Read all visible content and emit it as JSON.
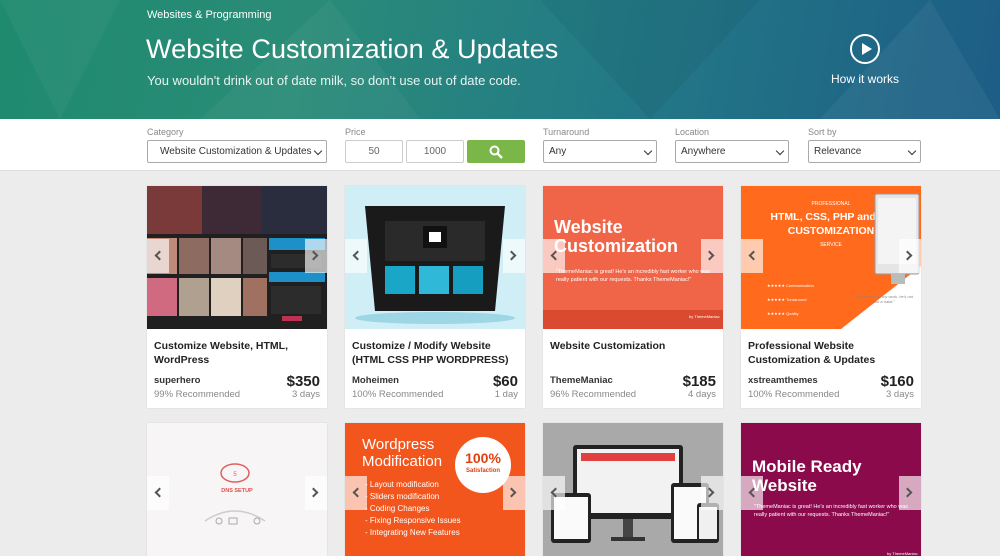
{
  "hero": {
    "breadcrumb": "Websites & Programming",
    "title": "Website Customization & Updates",
    "subtitle": "You wouldn't drink out of date milk, so don't use out of date code.",
    "how_it_works": "How it works"
  },
  "filters": {
    "category_label": "Category",
    "category_value": "Website Customization & Updates",
    "price_label": "Price",
    "price_min": "50",
    "price_max": "1000",
    "turnaround_label": "Turnaround",
    "turnaround_value": "Any",
    "location_label": "Location",
    "location_value": "Anywhere",
    "sort_label": "Sort by",
    "sort_value": "Relevance"
  },
  "cards": [
    {
      "title": "Customize Website, HTML, WordPress",
      "seller": "superhero",
      "recommended": "99% Recommended",
      "price": "$350",
      "days": "3 days"
    },
    {
      "title": "Customize / Modify Website (HTML CSS PHP WORDPRESS)",
      "seller": "Moheimen",
      "recommended": "100% Recommended",
      "price": "$60",
      "days": "1 day"
    },
    {
      "title": "Website Customization",
      "seller": "ThemeManiac",
      "recommended": "96% Recommended",
      "price": "$185",
      "days": "4 days"
    },
    {
      "title": "Professional Website Customization & Updates",
      "seller": "xstreamthemes",
      "recommended": "100% Recommended",
      "price": "$160",
      "days": "3 days"
    }
  ],
  "thumbs": {
    "card3_heading": "Website Customization",
    "card3_quote": "\"ThemeManiac is great! He's an incredibly fast worker who was really patient with our requests. Thanks ThemeManiac!\"",
    "card3_by": "by ThemeManiac",
    "card4_pre": "PROFESSIONAL",
    "card4_heading": "HTML, CSS, PHP and JS CUSTOMIZATION",
    "card4_post": "SERVICE",
    "card4_communication": "Communication",
    "card4_turnaround": "Turnaround",
    "card4_quality": "Quality",
    "card4_quote": "\"He are vital to my work, he's not just a habit.\"",
    "card5_label": "DNS SETUP",
    "card6_heading": "Wordpress Modification",
    "card6_badge_pct": "100%",
    "card6_badge_txt": "Satisfaction",
    "card6_items": [
      "- Layout modification",
      "- Sliders modification",
      "- Coding Changes",
      "- Fixing Responsive Issues",
      "- Integrating New Features"
    ],
    "card8_heading": "Mobile Ready Website",
    "card8_quote": "\"ThemeManiac is great! He's an incredibly fast worker who was really patient with our requests. Thanks ThemeManiac!\"",
    "card8_by": "by ThemeManiac"
  },
  "colors": {
    "go_button": "#7ab648",
    "card3_bg": "#f06548",
    "card4_bg": "#ff6a1c",
    "card6_bg": "#f2561d",
    "card8_bg": "#8a0a4c"
  }
}
